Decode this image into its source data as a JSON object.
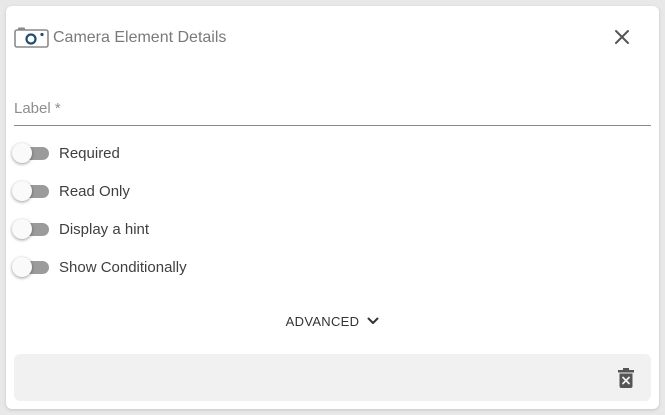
{
  "dialog": {
    "title": "Camera Element Details",
    "icon": "camera-icon",
    "close_icon": "close-icon"
  },
  "label_field": {
    "label": "Label *",
    "value": ""
  },
  "toggles": [
    {
      "label": "Required",
      "checked": false
    },
    {
      "label": "Read Only",
      "checked": false
    },
    {
      "label": "Display a hint",
      "checked": false
    },
    {
      "label": "Show Conditionally",
      "checked": false
    }
  ],
  "advanced": {
    "label": "ADVANCED",
    "icon": "chevron-down-icon"
  },
  "footer": {
    "delete_icon": "delete-icon"
  },
  "colors": {
    "accent": "#1e4f6e",
    "track": "#9b9b9b",
    "footer_bg": "#f1f1f1"
  }
}
